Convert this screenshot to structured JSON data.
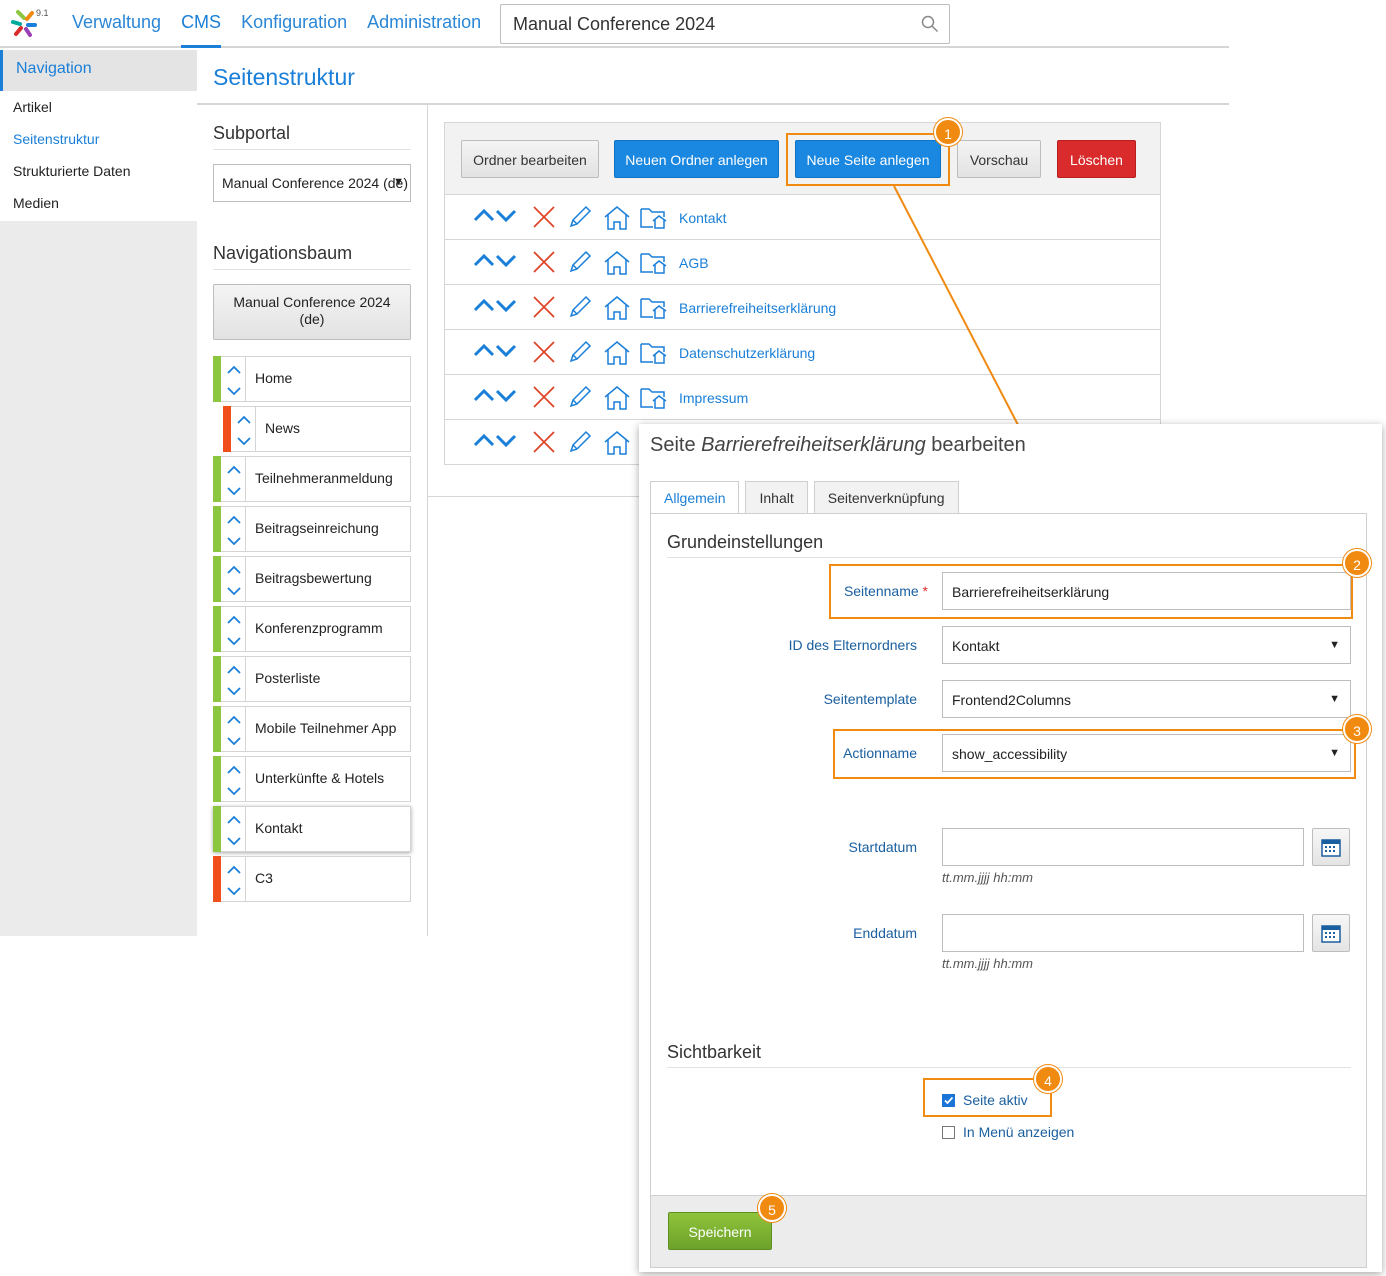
{
  "app": {
    "version": "9.1"
  },
  "topnav": {
    "items": [
      "Verwaltung",
      "CMS",
      "Konfiguration",
      "Administration"
    ],
    "active": "CMS",
    "search_value": "Manual Conference 2024"
  },
  "sidebar": {
    "heading": "Navigation",
    "items": [
      "Artikel",
      "Seitenstruktur",
      "Strukturierte Daten",
      "Medien"
    ],
    "active": "Seitenstruktur"
  },
  "page": {
    "title": "Seitenstruktur"
  },
  "subportal": {
    "title": "Subportal",
    "selected": "Manual Conference 2024 (de)"
  },
  "navtree": {
    "title": "Navigationsbaum",
    "root_line1": "Manual Conference 2024",
    "root_line2": "(de)",
    "items": [
      {
        "label": "Home",
        "status": "active",
        "level": 0
      },
      {
        "label": "News",
        "status": "inactive",
        "level": 1
      },
      {
        "label": "Teilnehmeranmeldung",
        "status": "active",
        "level": 0
      },
      {
        "label": "Beitragseinreichung",
        "status": "active",
        "level": 0
      },
      {
        "label": "Beitragsbewertung",
        "status": "active",
        "level": 0
      },
      {
        "label": "Konferenzprogramm",
        "status": "active",
        "level": 0
      },
      {
        "label": "Posterliste",
        "status": "active",
        "level": 0
      },
      {
        "label": "Mobile Teilnehmer App",
        "status": "active",
        "level": 0
      },
      {
        "label": "Unterkünfte & Hotels",
        "status": "active",
        "level": 0
      },
      {
        "label": "Kontakt",
        "status": "active",
        "level": 0,
        "selected": true
      },
      {
        "label": "C3",
        "status": "inactive",
        "level": 0
      }
    ]
  },
  "toolbar": {
    "edit_folder": "Ordner bearbeiten",
    "new_folder": "Neuen Ordner anlegen",
    "new_page": "Neue Seite anlegen",
    "preview": "Vorschau",
    "delete": "Löschen"
  },
  "pages": [
    "Kontakt",
    "AGB",
    "Barrierefreiheitserklärung",
    "Datenschutzerklärung",
    "Impressum",
    ""
  ],
  "callouts": [
    "1",
    "2",
    "3",
    "4",
    "5"
  ],
  "dialog": {
    "title_prefix": "Seite ",
    "title_name": "Barrierefreiheitserklärung",
    "title_suffix": " bearbeiten",
    "tabs": [
      "Allgemein",
      "Inhalt",
      "Seitenverknüpfung"
    ],
    "active_tab": "Allgemein",
    "section_basic": "Grundeinstellungen",
    "fields": {
      "seitenname_label": "Seitenname",
      "seitenname_value": "Barrierefreiheitserklärung",
      "parent_label": "ID des Elternordners",
      "parent_value": "Kontakt",
      "template_label": "Seitentemplate",
      "template_value": "Frontend2Columns",
      "action_label": "Actionname",
      "action_value": "show_accessibility",
      "start_label": "Startdatum",
      "start_value": "",
      "end_label": "Enddatum",
      "end_value": "",
      "date_hint": "tt.mm.jjjj hh:mm"
    },
    "section_visibility": "Sichtbarkeit",
    "visibility": {
      "active_label": "Seite aktiv",
      "active_checked": true,
      "menu_label": "In Menü anzeigen",
      "menu_checked": false
    },
    "save": "Speichern"
  },
  "colors": {
    "accent": "#1a7fd8",
    "callout": "#f08a10",
    "status_active": "#8cc63f",
    "status_inactive": "#f04e1a",
    "danger": "#d92b2b",
    "save": "#7ab030"
  }
}
